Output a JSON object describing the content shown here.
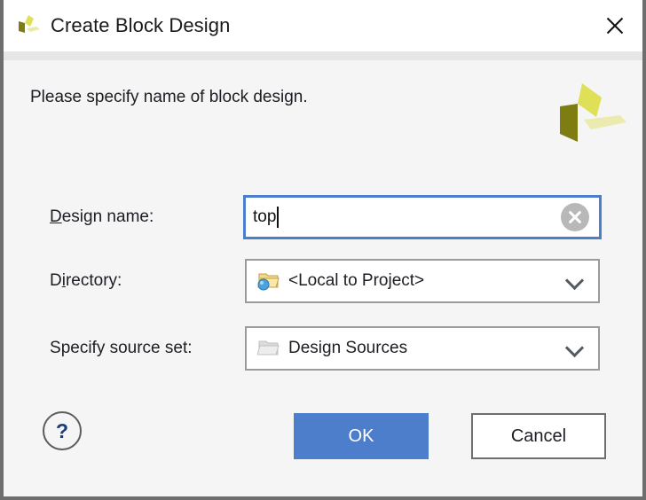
{
  "window": {
    "title": "Create Block Design",
    "logo_icon": "vivado-pinwheel-icon",
    "close_icon": "close-icon"
  },
  "body": {
    "instruction": "Please specify name of block design.",
    "brand_logo_icon": "vivado-pinwheel-large-icon"
  },
  "fields": {
    "design_name": {
      "label_prefix": "",
      "label_mnemonic": "D",
      "label_suffix": "esign name:",
      "value": "top",
      "placeholder": "",
      "clear_icon": "clear-circle-icon",
      "focused": true
    },
    "directory": {
      "label_prefix": "D",
      "label_mnemonic": "i",
      "label_suffix": "rectory:",
      "value": "<Local to Project>",
      "icon": "folder-project-icon",
      "chevron_icon": "chevron-down-icon"
    },
    "source_set": {
      "label_prefix": "",
      "label_mnemonic": "S",
      "label_suffix": "pecify source set:",
      "value": "Design Sources",
      "icon": "folder-icon",
      "chevron_icon": "chevron-down-icon"
    }
  },
  "buttons": {
    "help": "?",
    "ok": "OK",
    "cancel": "Cancel"
  },
  "colors": {
    "accent_blue": "#4d7ecc",
    "dialog_bg": "#f5f5f5",
    "titlebar_bg": "#ffffff",
    "border_gray": "#6e6e6e",
    "logo_bright": "#dfdf58",
    "logo_dark": "#7d7d11",
    "logo_pale": "#ebebb0"
  }
}
